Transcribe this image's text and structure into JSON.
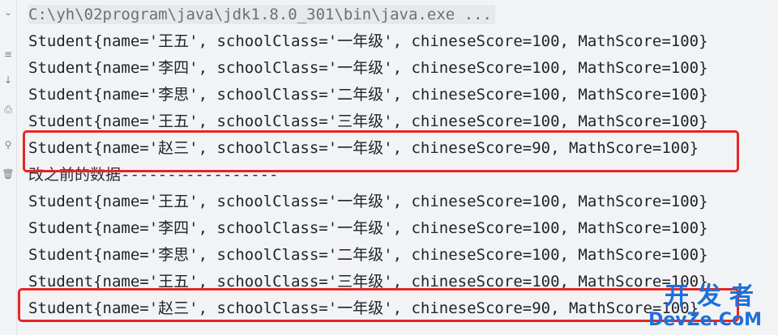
{
  "gutter_icons": [
    {
      "name": "collapse-icon",
      "glyph": "⌄"
    },
    {
      "name": "wrap-icon",
      "glyph": "≡"
    },
    {
      "name": "scroll-end-icon",
      "glyph": "↓"
    },
    {
      "name": "print-icon",
      "glyph": "⎙"
    },
    {
      "name": "pin-icon",
      "glyph": "⚲"
    },
    {
      "name": "delete-icon",
      "glyph": "🗑"
    }
  ],
  "console": {
    "command": "C:\\yh\\02program\\java\\jdk1.8.0_301\\bin\\java.exe ...",
    "lines_before": [
      "Student{name='王五', schoolClass='一年级', chineseScore=100, MathScore=100}",
      "Student{name='李四', schoolClass='一年级', chineseScore=100, MathScore=100}",
      "Student{name='李思', schoolClass='二年级', chineseScore=100, MathScore=100}",
      "Student{name='王五', schoolClass='三年级', chineseScore=100, MathScore=100}",
      "Student{name='赵三', schoolClass='一年级', chineseScore=90, MathScore=100}"
    ],
    "separator": "改之前的数据-----------------",
    "lines_after": [
      "Student{name='王五', schoolClass='一年级', chineseScore=100, MathScore=100}",
      "Student{name='李四', schoolClass='一年级', chineseScore=100, MathScore=100}",
      "Student{name='李思', schoolClass='二年级', chineseScore=100, MathScore=100}",
      "Student{name='王五', schoolClass='三年级', chineseScore=100, MathScore=100}",
      "Student{name='赵三', schoolClass='一年级', chineseScore=90, MathScore=100}"
    ]
  },
  "watermark": {
    "top": "开发者",
    "bottom": "DevZe.CoM"
  },
  "colors": {
    "highlight": "#e52626",
    "watermark": "#1e6fd9",
    "background": "#f2f3f5"
  }
}
